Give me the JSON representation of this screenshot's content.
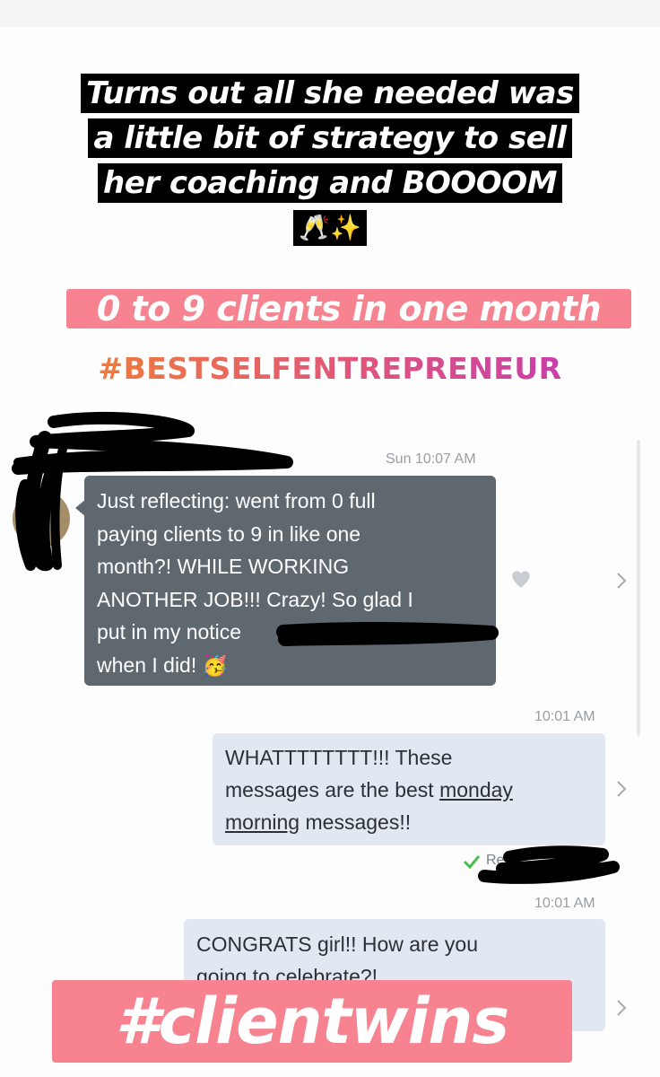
{
  "story": {
    "headline_lines": [
      "Turns out all she needed was",
      "a little bit of strategy to sell",
      "her coaching and BOOOOM"
    ],
    "headline_emoji": "🥂✨",
    "banner": "0 to 9 clients in one month",
    "hashtag": "#BESTSELFENTREPRENEUR",
    "footer_tag": "#clientwins"
  },
  "conversation": {
    "messages": [
      {
        "direction": "incoming",
        "timestamp": "Sun 10:07 AM",
        "lines": [
          "Just reflecting: went from 0 full",
          "paying clients to 9 in like one",
          "month?! WHILE WORKING",
          "ANOTHER JOB!!! Crazy! So glad I",
          "put in my notice",
          "when I did! 🥳"
        ]
      },
      {
        "direction": "outgoing",
        "timestamp": "10:01 AM",
        "line1": "WHATTTTTTTT!!! These",
        "line2_plain": "messages are the best ",
        "line2_underlined": "monday",
        "line3_underlined": "morning",
        "line3_plain": " messages!!",
        "read_receipt": "Re"
      },
      {
        "direction": "outgoing",
        "timestamp": "10:01 AM",
        "line1": "CONGRATS girl!! How are you",
        "line2": "going to celebrate?!"
      }
    ]
  },
  "colors": {
    "banner_pink": "#f6838f",
    "incoming_bubble": "#5f676f",
    "outgoing_bubble": "#e2e8f2",
    "hashtag_gradient_start": "#f07a3c",
    "hashtag_gradient_end": "#c83fa9",
    "read_check": "#4cbb50"
  },
  "icons": [
    "heart-icon",
    "chevron-right-icon",
    "check-icon"
  ]
}
